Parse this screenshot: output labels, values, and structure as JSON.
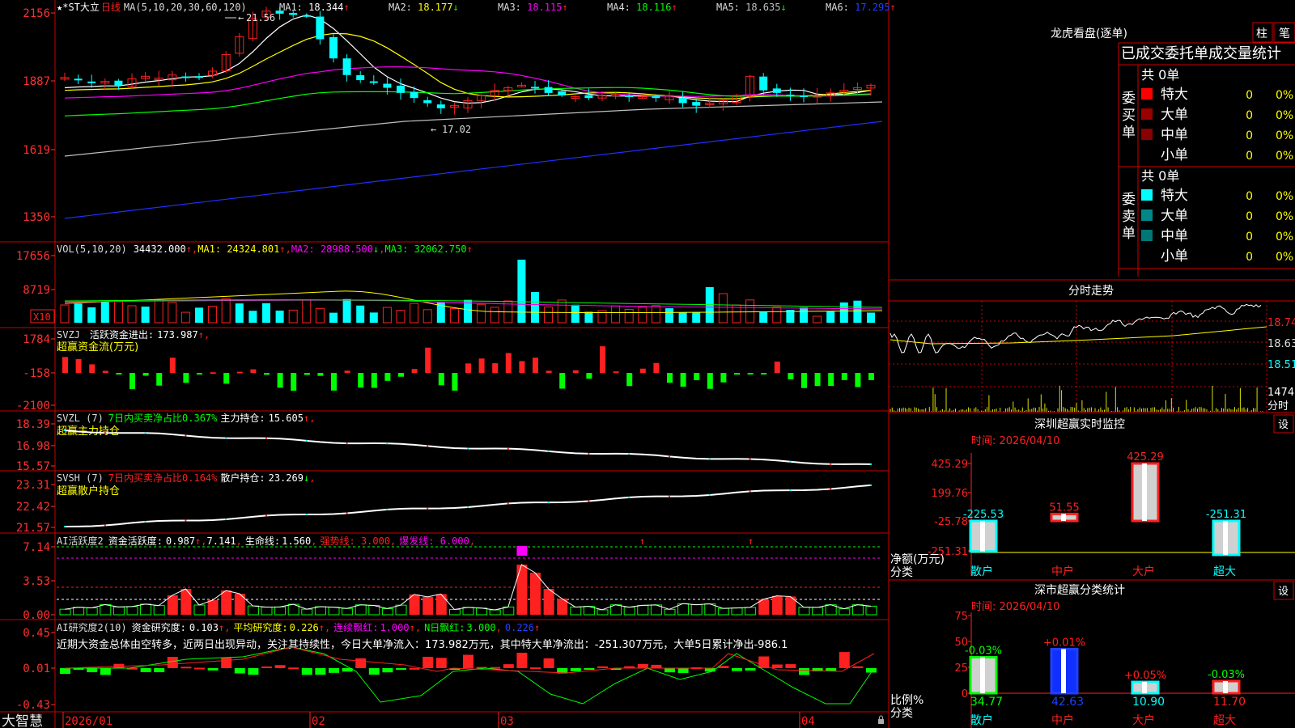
{
  "colors": {
    "up": "#ff2020",
    "down": "#00ffff",
    "ma1": "#ffffff",
    "ma2": "#ffff00",
    "ma3": "#ff00ff",
    "ma4": "#00ff00",
    "ma5": "#c0c0c0",
    "ma6": "#2030ff",
    "grid": "#cc0000",
    "white": "#e8e8e8",
    "yellow": "#ffff00",
    "magenta": "#ff00ff",
    "green": "#00ff00",
    "cyan": "#00ffff",
    "blue": "#2040ff",
    "red": "#ff2020"
  },
  "app": {
    "brand": "大智慧"
  },
  "kline": {
    "stock": "★*ST大立",
    "period": "日线",
    "ma_header": "MA(5,10,20,30,60,120)",
    "indicators": [
      {
        "label": "MA1:",
        "value": "18.344",
        "arrow": "↑",
        "color": "#ffffff"
      },
      {
        "label": "MA2:",
        "value": "18.177",
        "arrow": "↓",
        "color": "#ffff00"
      },
      {
        "label": "MA3:",
        "value": "18.115",
        "arrow": "↑",
        "color": "#ff00ff"
      },
      {
        "label": "MA4:",
        "value": "18.116",
        "arrow": "↑",
        "color": "#00ff00"
      },
      {
        "label": "MA5:",
        "value": "18.635",
        "arrow": "↓",
        "color": "#c0c0c0"
      },
      {
        "label": "MA6:",
        "value": "17.295",
        "arrow": "↑",
        "color": "#2040ff"
      }
    ],
    "y_axis": [
      "2156",
      "1887",
      "1619",
      "1350"
    ],
    "high_mark": "21.56",
    "low_mark": "17.02"
  },
  "vol": {
    "header": "VOL(5,10,20)",
    "value": "34432.000",
    "arrow": "↑",
    "ma1": "MA1: 24324.801",
    "ma1_arrow": "↑",
    "ma2": "MA2: 28988.500",
    "ma2_arrow": "↓",
    "ma3": "MA3: 32062.750",
    "ma3_arrow": "↑",
    "y_axis": [
      "17656",
      "8719"
    ],
    "unit": "X10"
  },
  "svzj": {
    "header": "SVZJ",
    "label": "活跃资金进出:",
    "value": "173.987",
    "arrow": "↑",
    "subtitle": "超赢资金流(万元)",
    "y_axis": [
      "1784",
      "-158",
      "-2100"
    ]
  },
  "svzl": {
    "header": "SVZL (7)",
    "label1": "7日内买卖净占比0.367%",
    "label2": "主力持仓:",
    "value": "15.605",
    "arrow": "↑",
    "subtitle": "超赢主力持仓",
    "y_axis": [
      "18.39",
      "16.98",
      "15.57"
    ]
  },
  "svsh": {
    "header": "SVSH (7)",
    "label1": "7日内买卖净占比0.164%",
    "label2": "散户持仓:",
    "value": "23.269",
    "arrow": "↓",
    "subtitle": "超赢散户持仓",
    "y_axis": [
      "23.31",
      "22.42",
      "21.57"
    ]
  },
  "ai_active": {
    "header": "AI活跃度2",
    "label": "资金活跃度:",
    "value": "0.987",
    "arrow": "↑",
    "v2": "7.141",
    "life": "生命线:",
    "life_v": "1.560",
    "strong": "强势线: 3.000",
    "burst": "爆发线: 6.000",
    "y_axis": [
      "7.14",
      "3.53",
      "0.00"
    ]
  },
  "ai_research": {
    "header": "AI研究度2(10)",
    "label": "资金研究度:",
    "value": "0.103",
    "arrow": "↑",
    "avg": "平均研究度:",
    "avg_v": "0.226",
    "avg_arrow": "↑",
    "cont": "连续飘红:",
    "cont_v": "1.000",
    "cont_arrow": "↑",
    "n": "N日飘红:",
    "n_v": "3.000",
    "n_v2": "0.226",
    "n_arrow": "↑",
    "text": "近期大资金总体由空转多，近两日出现异动，关注其持续性，今日大单净流入：173.982万元，其中特大单净流出：-251.307万元，大单5日累计净出-986.1",
    "y_axis": [
      "0.45",
      "0.01",
      "-0.43"
    ]
  },
  "dates": [
    "2026/01",
    "02",
    "03",
    "04"
  ],
  "dragon": {
    "title": "龙虎看盘(逐单)",
    "btn1": "柱",
    "btn2": "笔",
    "header": "已成交委托单成交量统计",
    "buy": {
      "side": "委买单",
      "total": "共 0单",
      "rows": [
        {
          "label": "特大",
          "value": "0",
          "pct": "0%",
          "color": "#ff0000"
        },
        {
          "label": "大单",
          "value": "0",
          "pct": "0%",
          "color": "#990000"
        },
        {
          "label": "中单",
          "value": "0",
          "pct": "0%",
          "color": "#880000"
        },
        {
          "label": "小单",
          "value": "0",
          "pct": "0%",
          "color": ""
        }
      ]
    },
    "sell": {
      "side": "委卖单",
      "total": "共 0单",
      "rows": [
        {
          "label": "特大",
          "value": "0",
          "pct": "0%",
          "color": "#00ffff"
        },
        {
          "label": "大单",
          "value": "0",
          "pct": "0%",
          "color": "#008888"
        },
        {
          "label": "中单",
          "value": "0",
          "pct": "0%",
          "color": "#007777"
        },
        {
          "label": "小单",
          "value": "0",
          "pct": "0%",
          "color": ""
        }
      ]
    }
  },
  "intraday": {
    "title": "分时走势",
    "y_axis": [
      "18.74",
      "18.63",
      "18.51"
    ],
    "vol_label": "1474",
    "time_label": "分时"
  },
  "sz_monitor": {
    "title": "深圳超赢实时监控",
    "settings": "设",
    "time_label": "时间: 2026/04/10",
    "y_axis": [
      "425.29",
      "199.76",
      "-25.78",
      "-251.31"
    ],
    "net_label": "净额(万元)",
    "cat_label": "分类",
    "categories": [
      "散户",
      "中户",
      "大户",
      "超大"
    ],
    "values": [
      -225.53,
      51.55,
      425.29,
      -251.31
    ],
    "value_labels": [
      "-225.53",
      "51.55",
      "425.29",
      "-251.31"
    ]
  },
  "sz_class": {
    "title": "深市超赢分类统计",
    "settings": "设",
    "time_label": "时间: 2026/04/10",
    "y_axis": [
      "75",
      "50",
      "25",
      "0"
    ],
    "ratio_label": "比例%",
    "cat_label": "分类",
    "categories": [
      "散户",
      "中户",
      "大户",
      "超大"
    ],
    "values": [
      34.77,
      42.63,
      10.9,
      11.7
    ],
    "value_labels": [
      "34.77",
      "42.63",
      "10.90",
      "11.70"
    ],
    "change_labels": [
      "-0.03%",
      "+0.01%",
      "+0.05%",
      "-0.03%"
    ]
  }
}
